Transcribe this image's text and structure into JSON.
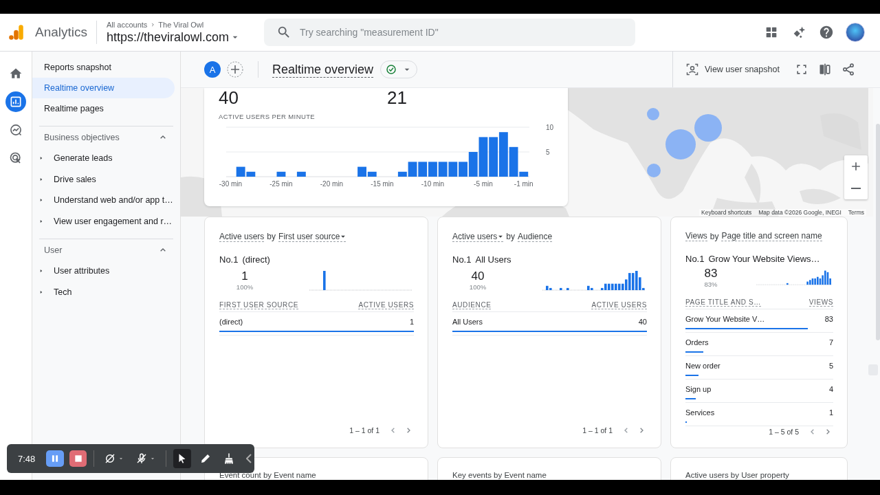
{
  "header": {
    "product": "Analytics",
    "breadcrumb": [
      "All accounts",
      "The Viral Owl"
    ],
    "property": "https://theviralowl.com",
    "search": {
      "placeholder": "Try searching \"measurement ID\""
    }
  },
  "nav_rail": [
    {
      "kind": "home",
      "selected": false
    },
    {
      "kind": "reports",
      "selected": true
    },
    {
      "kind": "explore",
      "selected": false
    },
    {
      "kind": "advertising",
      "selected": false
    }
  ],
  "sidebar": {
    "items": [
      {
        "label": "Reports snapshot",
        "selected": false
      },
      {
        "label": "Realtime overview",
        "selected": true
      },
      {
        "label": "Realtime pages",
        "selected": false
      }
    ],
    "sections": [
      {
        "title": "Business objectives",
        "expanded": true,
        "items": [
          {
            "label": "Generate leads",
            "expanded": false
          },
          {
            "label": "Drive sales",
            "expanded": false
          },
          {
            "label": "Understand web and/or app t…",
            "expanded": false
          },
          {
            "label": "View user engagement and r…",
            "expanded": false
          }
        ]
      },
      {
        "title": "User",
        "expanded": true,
        "items": [
          {
            "label": "User attributes",
            "expanded": false
          },
          {
            "label": "Tech",
            "expanded": false
          }
        ]
      }
    ]
  },
  "toolbar": {
    "comparison": "A",
    "title": "Realtime overview",
    "verified": true,
    "snapshot_button": "View user snapshot"
  },
  "realtime_card": {
    "metrics": [
      "40",
      "21"
    ],
    "chart_title": "ACTIVE USERS PER MINUTE",
    "chart_data": {
      "type": "bar",
      "x": [
        -30,
        -29,
        -28,
        -27,
        -26,
        -25,
        -24,
        -23,
        -22,
        -21,
        -20,
        -19,
        -18,
        -17,
        -16,
        -15,
        -14,
        -13,
        -12,
        -11,
        -10,
        -9,
        -8,
        -7,
        -6,
        -5,
        -4,
        -3,
        -2,
        -1
      ],
      "series": [
        {
          "color": "#1a73e8",
          "values": [
            0,
            2,
            1,
            0,
            0,
            1,
            0,
            1,
            0,
            0,
            0,
            0,
            0,
            2,
            1,
            0,
            0,
            1,
            3,
            3,
            3,
            3,
            3,
            3,
            5,
            8,
            8,
            9,
            6,
            1
          ]
        }
      ],
      "xlim": [
        -30.5,
        -0.5
      ],
      "ylim": [
        0,
        10
      ],
      "yticks": [
        5,
        10
      ],
      "xticks": [
        {
          "value": -30,
          "label": "-30 min"
        },
        {
          "value": -25,
          "label": "-25 min"
        },
        {
          "value": -20,
          "label": "-20 min"
        },
        {
          "value": -15,
          "label": "-15 min"
        },
        {
          "value": -10,
          "label": "-10 min"
        },
        {
          "value": -5,
          "label": "-5 min"
        },
        {
          "value": -1,
          "label": "-1 min"
        }
      ]
    }
  },
  "map": {
    "kind": "picture",
    "attribution": [
      "Keyboard shortcuts",
      "Map data ©2026 Google, INEGI",
      "Terms"
    ]
  },
  "cards": [
    {
      "title": [
        {
          "text": "Active users",
          "kind": "dimension",
          "dropdown": false
        },
        {
          "text": "by",
          "kind": "plain"
        },
        {
          "text": "First user source",
          "kind": "dimension",
          "dropdown": true
        }
      ],
      "top": {
        "rank": "No.1",
        "name": "(direct)",
        "value": "1",
        "share": "100%"
      },
      "columns": [
        "FIRST USER SOURCE",
        "ACTIVE USERS"
      ],
      "rows": [
        {
          "label": "(direct)",
          "value": "1",
          "level": 1
        }
      ],
      "pagination": "1 – 1 of 1"
    },
    {
      "title": [
        {
          "text": "Active users",
          "kind": "dimension",
          "dropdown": true
        },
        {
          "text": "by",
          "kind": "plain"
        },
        {
          "text": "Audience",
          "kind": "dimension",
          "dropdown": false
        }
      ],
      "top": {
        "rank": "No.1",
        "name": "All Users",
        "value": "40",
        "share": "100%"
      },
      "columns": [
        "AUDIENCE",
        "ACTIVE USERS"
      ],
      "rows": [
        {
          "label": "All Users",
          "value": "40",
          "level": 1
        }
      ],
      "pagination": "1 – 1 of 1"
    },
    {
      "title": [
        {
          "text": "Views",
          "kind": "dimension",
          "dropdown": false
        },
        {
          "text": "by",
          "kind": "plain"
        },
        {
          "text": "Page title and screen name",
          "kind": "dimension",
          "dropdown": false
        }
      ],
      "top": {
        "rank": "No.1",
        "name": "Grow Your Website Views…",
        "value": "83",
        "share": "83%"
      },
      "columns": [
        "PAGE TITLE AND S…",
        "VIEWS"
      ],
      "rows": [
        {
          "label": "Grow Your Website V…",
          "value": "83",
          "level": 0.83
        },
        {
          "label": "Orders",
          "value": "7",
          "level": 0.12
        },
        {
          "label": "New order",
          "value": "5",
          "level": 0.09
        },
        {
          "label": "Sign up",
          "value": "4",
          "level": 0.07
        },
        {
          "label": "Services",
          "value": "1",
          "level": 0.01
        }
      ],
      "pagination": "1 – 5 of 5"
    }
  ],
  "more_cards": [
    "Event count by Event name",
    "Key events by Event name",
    "Active users by User property"
  ],
  "recorder": {
    "time": "7:48"
  }
}
